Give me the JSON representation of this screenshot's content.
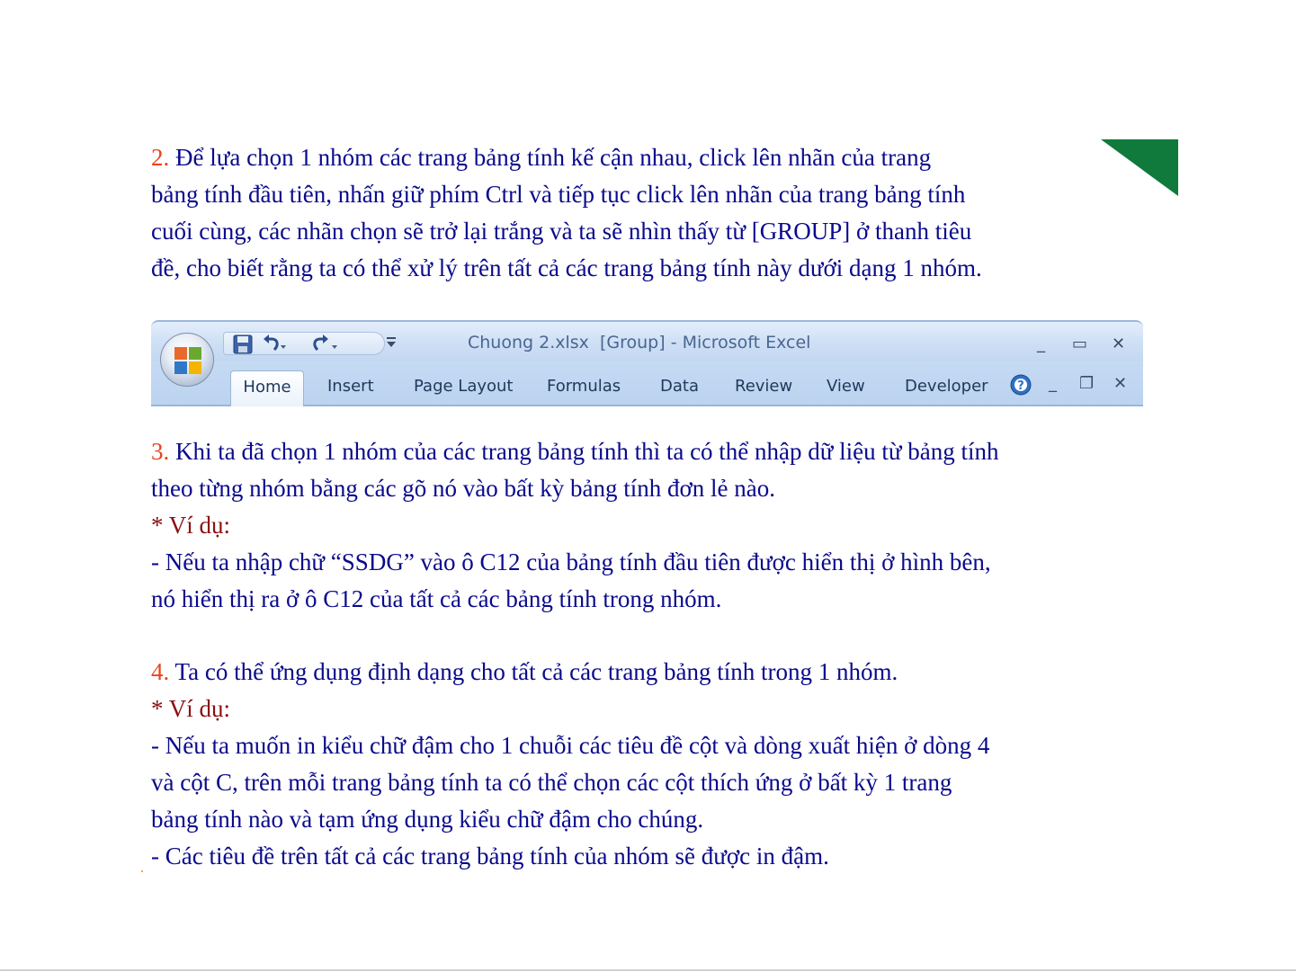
{
  "paragraphs": {
    "p2": {
      "number": "2.",
      "lines": [
        " Để lựa chọn 1 nhóm các trang bảng tính kế cận nhau, click lên nhãn của trang",
        "bảng tính đầu tiên, nhấn giữ phím Ctrl và tiếp tục click lên nhãn của trang bảng tính",
        "cuối cùng, các nhãn chọn sẽ trở lại trắng và ta sẽ nhìn thấy từ [GROUP] ở thanh tiêu",
        "đề, cho biết rằng ta có thể xử lý trên tất cả các trang bảng tính này dưới dạng 1 nhóm."
      ]
    },
    "p3": {
      "number": "3.",
      "line1": " Khi ta đã chọn 1 nhóm của các trang bảng tính thì ta có thể nhập dữ liệu từ bảng tính",
      "line2": "theo từng nhóm bằng các gõ nó vào bất kỳ bảng tính đơn lẻ nào.",
      "example_label": "* Ví dụ:",
      "line4": "- Nếu ta nhập chữ  “SSDG” vào ô C12 của bảng tính đầu tiên được hiển thị ở hình bên,",
      "line5": "nó hiển thị ra ở ô C12 của tất cả các bảng tính trong nhóm."
    },
    "p4": {
      "number": "4.",
      "line1": " Ta có thể ứng dụng định dạng cho tất cả các trang bảng tính trong 1 nhóm.",
      "example_label": "* Ví dụ:",
      "line3": "- Nếu ta muốn in kiểu chữ đậm cho 1 chuỗi các tiêu đề cột và dòng xuất hiện ở dòng 4",
      "line4": "và cột C, trên mỗi trang bảng tính ta có thể chọn các cột thích ứng ở bất kỳ 1 trang",
      "line5": "bảng tính nào và tạm ứng dụng kiểu chữ đậm cho chúng.",
      "line6": "- Các tiêu đề trên tất cả các trang bảng tính của nhóm sẽ được in đậm."
    }
  },
  "excel": {
    "title": "Chuong 2.xlsx  [Group] - Microsoft Excel",
    "tabs": [
      "Home",
      "Insert",
      "Page Layout",
      "Formulas",
      "Data",
      "Review",
      "View",
      "Developer"
    ],
    "window_controls": [
      "_",
      "▭",
      "✕"
    ],
    "ribbon_controls": [
      "_",
      "❐",
      "✕"
    ],
    "icons": {
      "office_button": "office-logo-icon",
      "save": "save-icon",
      "undo": "undo-icon",
      "redo": "redo-icon",
      "customize": "customize-qat-icon",
      "help": "help-icon"
    }
  },
  "colors": {
    "body_text": "#0a0a8c",
    "number": "#e8451c",
    "example_label": "#8c0f12",
    "corner_accent": "#0f7a3c"
  }
}
